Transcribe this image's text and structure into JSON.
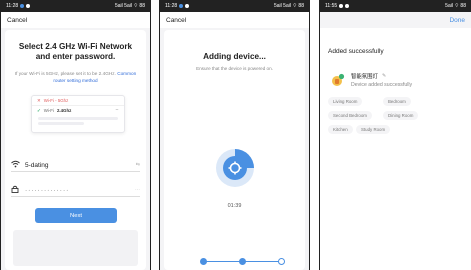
{
  "screen1": {
    "status_time": "11:28",
    "status_right": "5ail 5ail ⌔ 88",
    "cancel_label": "Cancel",
    "title": "Select 2.4 GHz Wi-Fi Network and enter password.",
    "subtitle_text": "If your Wi-Fi is 5GHz, please set it to be 2.4GHz.",
    "subtitle_link": "Common router setting method",
    "illustration": {
      "row1": "Wi-Fi - 5Ghz",
      "row2_prefix": "Wi-Fi",
      "row2_value": "2.4Ghz"
    },
    "ssid_value": "5-dating",
    "ssid_trailing": "⇆",
    "password_value": "··············",
    "password_trailing": "⋯",
    "next_label": "Next"
  },
  "screen2": {
    "status_time": "11:28",
    "status_right": "5ail 5ail ⌔ 88",
    "cancel_label": "Cancel",
    "title": "Adding device...",
    "subtitle": "Ensure that the device is powered on.",
    "timer": "01:39"
  },
  "screen3": {
    "status_time": "11:55",
    "status_right": "5ail ⌔ 88",
    "done_label": "Done",
    "heading": "Added successfully",
    "device_name": "智能氛围灯",
    "device_status": "Device added successfully",
    "rooms": [
      "Living Room",
      "Bedroom",
      "Second Bedroom",
      "Dining Room",
      "Kitchen",
      "Study Room"
    ]
  },
  "colors": {
    "accent": "#4a90e2",
    "link": "#2f6bd8",
    "success": "#3bb273",
    "error": "#e05a5a"
  }
}
